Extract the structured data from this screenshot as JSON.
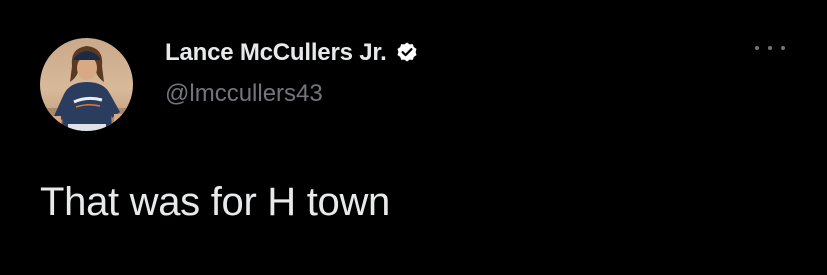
{
  "author": {
    "display_name": "Lance McCullers Jr.",
    "handle": "@lmccullers43",
    "verified": true,
    "avatar_icon": "profile-photo-baseball-player"
  },
  "tweet": {
    "text": "That was for H town"
  },
  "actions": {
    "more_icon": "more-options-icon"
  },
  "colors": {
    "background": "#000000",
    "primary_text": "#e7e9ea",
    "secondary_text": "#71767b",
    "verified_badge": "#ffffff"
  }
}
